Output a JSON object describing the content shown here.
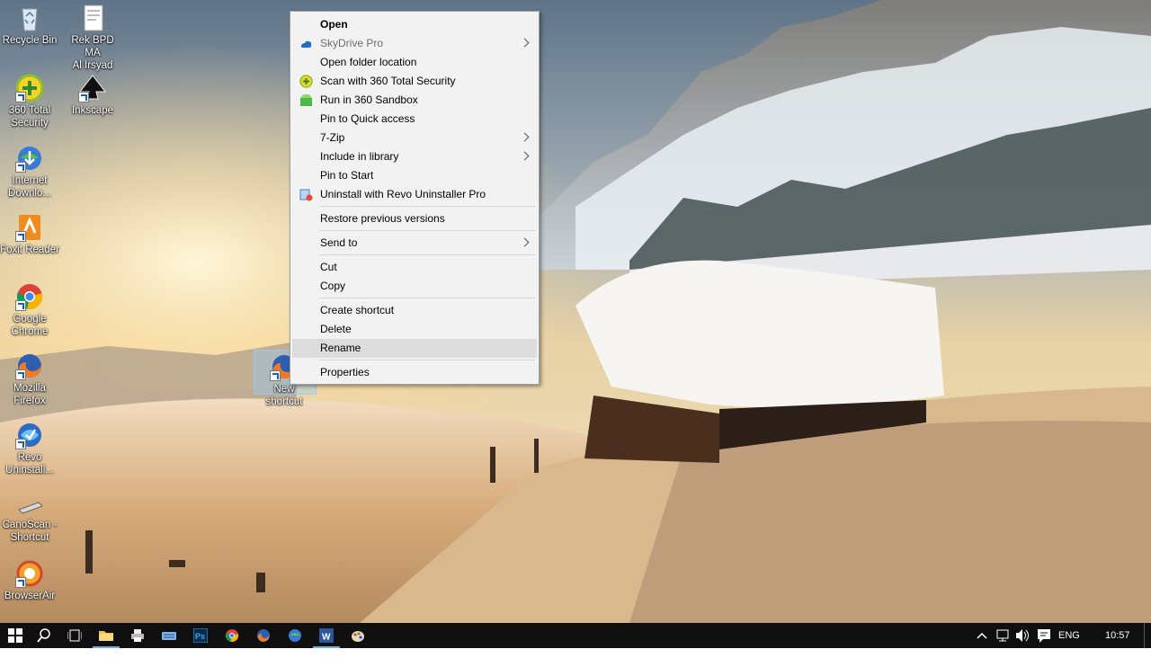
{
  "desktop": {
    "icons": [
      {
        "label": "Recycle Bin",
        "icon": "recycle-bin-icon"
      },
      {
        "label": "Rek BPD MA\nAl Irsyad",
        "icon": "document-icon"
      },
      {
        "label": "360 Total\nSecurity",
        "icon": "360-total-security-icon"
      },
      {
        "label": "Inkscape",
        "icon": "inkscape-icon"
      },
      {
        "label": "Internet\nDownlo...",
        "icon": "internet-download-manager-icon"
      },
      {
        "label": "Foxit Reader",
        "icon": "foxit-reader-icon"
      },
      {
        "label": "Google\nChrome",
        "icon": "chrome-icon"
      },
      {
        "label": "Mozilla\nFirefox",
        "icon": "firefox-icon"
      },
      {
        "label": "Revo\nUninstall...",
        "icon": "revo-uninstaller-icon"
      },
      {
        "label": "CanoScan -\nShortcut",
        "icon": "canoscan-icon"
      },
      {
        "label": "BrowserAir",
        "icon": "browserair-icon"
      },
      {
        "label": "New shortcut",
        "icon": "firefox-icon"
      }
    ]
  },
  "context_menu": {
    "items": [
      {
        "label": "Open",
        "bold": true
      },
      {
        "label": "SkyDrive Pro",
        "disabled": true,
        "submenu": true,
        "icon": "skydrive-icon"
      },
      {
        "label": "Open folder location"
      },
      {
        "label": "Scan with 360 Total Security",
        "icon": "360-scan-icon"
      },
      {
        "label": "Run in 360 Sandbox",
        "icon": "sandbox-icon"
      },
      {
        "label": "Pin to Quick access"
      },
      {
        "label": "7-Zip",
        "submenu": true
      },
      {
        "label": "Include in library",
        "submenu": true
      },
      {
        "label": "Pin to Start"
      },
      {
        "label": "Uninstall with Revo Uninstaller Pro",
        "icon": "revo-icon"
      },
      {
        "label": "Restore previous versions"
      },
      {
        "label": "Send to",
        "submenu": true
      },
      {
        "label": "Cut"
      },
      {
        "label": "Copy"
      },
      {
        "label": "Create shortcut"
      },
      {
        "label": "Delete"
      },
      {
        "label": "Rename",
        "highlighted": true
      },
      {
        "label": "Properties"
      }
    ]
  },
  "taskbar": {
    "apps": [
      "file-explorer-icon",
      "printer-icon",
      "keyboard-icon",
      "photoshop-icon",
      "chrome-icon",
      "firefox-icon",
      "download-manager-icon",
      "word-icon",
      "paint-icon"
    ],
    "language": "ENG",
    "clock": "10:57"
  },
  "colors": {
    "menu_bg": "#f2f2f2",
    "menu_highlight": "#dcdcdc",
    "taskbar_bg": "#101010"
  }
}
